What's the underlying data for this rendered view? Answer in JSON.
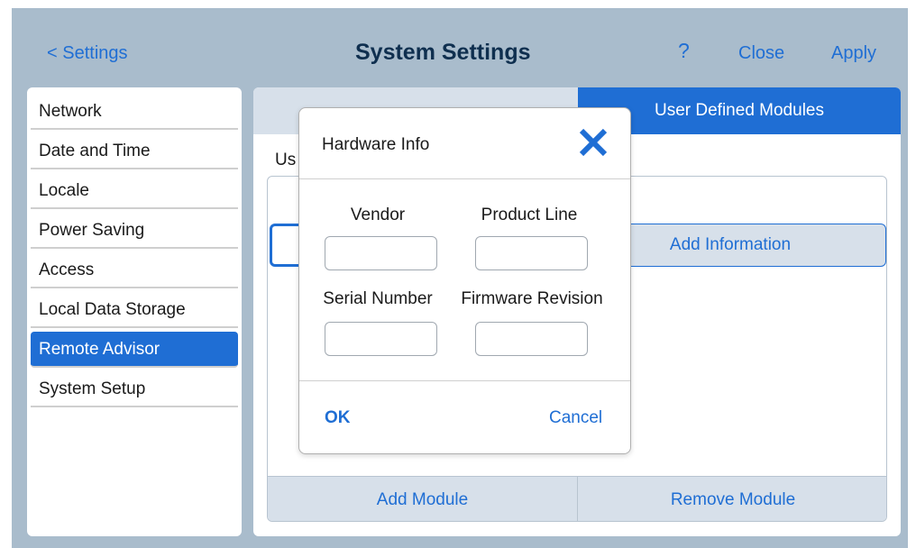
{
  "header": {
    "back_label": "< Settings",
    "title": "System Settings",
    "help_label": "?",
    "close_label": "Close",
    "apply_label": "Apply"
  },
  "sidebar": {
    "items": [
      {
        "label": "Network"
      },
      {
        "label": "Date and Time"
      },
      {
        "label": "Locale"
      },
      {
        "label": "Power Saving"
      },
      {
        "label": "Access"
      },
      {
        "label": "Local Data Storage"
      },
      {
        "label": "Remote Advisor",
        "active": true
      },
      {
        "label": "System Setup"
      }
    ]
  },
  "main": {
    "tabs": [
      {
        "label": "",
        "selected": false
      },
      {
        "label": "User Defined Modules",
        "selected": true
      }
    ],
    "sub_label": "Us",
    "add_information_label": "Add Information",
    "add_module_label": "Add Module",
    "remove_module_label": "Remove Module"
  },
  "dialog": {
    "title": "Hardware Info",
    "close_icon": "close-x-icon",
    "fields": {
      "vendor": {
        "label": "Vendor",
        "value": ""
      },
      "product_line": {
        "label": "Product Line",
        "value": ""
      },
      "serial_number": {
        "label": "Serial Number",
        "value": ""
      },
      "firmware_revision": {
        "label": "Firmware Revision",
        "value": ""
      }
    },
    "ok_label": "OK",
    "cancel_label": "Cancel"
  },
  "colors": {
    "accent": "#1f6ed4",
    "background": "#a9bccc",
    "title": "#0f2f4f",
    "tab_inactive": "#d7e0ea"
  }
}
